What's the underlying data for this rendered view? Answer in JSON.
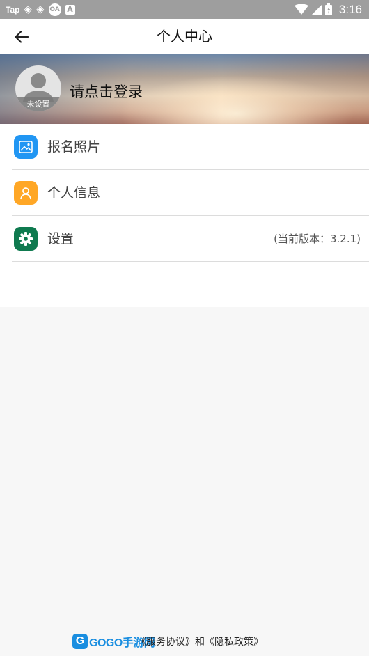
{
  "status_bar": {
    "left_label": "Tap",
    "badge_label": "OA",
    "square_label": "A",
    "time": "3:16"
  },
  "header": {
    "title": "个人中心"
  },
  "profile": {
    "avatar_label": "未设置",
    "login_prompt": "请点击登录"
  },
  "menu": {
    "items": [
      {
        "label": "报名照片",
        "icon": "photo-icon",
        "color": "#2196f3"
      },
      {
        "label": "个人信息",
        "icon": "person-icon",
        "color": "#ffa726"
      },
      {
        "label": "设置",
        "icon": "gear-icon",
        "color": "#0f7a4f",
        "extra": "(当前版本：3.2.1)"
      }
    ]
  },
  "footer": {
    "logo_mark": "G",
    "logo_text": "GOGO手游网",
    "service_agreement": "《服务协议》",
    "conjunction": "和",
    "privacy_policy": "《隐私政策》"
  }
}
